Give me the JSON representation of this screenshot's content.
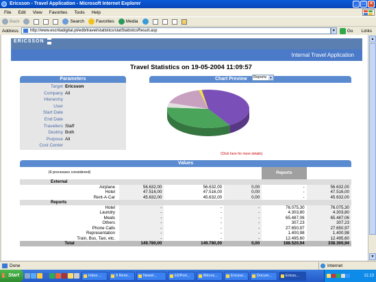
{
  "window": {
    "title": "Ericsson - Travel Application - Microsoft Internet Explorer",
    "min": "_",
    "max": "□",
    "close": "×"
  },
  "menu": [
    "File",
    "Edit",
    "View",
    "Favorites",
    "Tools",
    "Help"
  ],
  "toolbar": {
    "back": "Back",
    "search": "Search",
    "favorites": "Favorites",
    "media": "Media"
  },
  "address": {
    "label": "Address",
    "url": "http://www.escritadigital.pt/edb/travel/statistics/statStatisticsResult.asp",
    "go": "Go",
    "links": "Links"
  },
  "header": {
    "brand": "ERICSSON",
    "app_name": "Internal Travel Application"
  },
  "page_title": "Travel Statistics on 19-05-2004 11:09:57",
  "parameters": {
    "title": "Parameters",
    "rows": [
      {
        "k": "Target",
        "v": "Ericsson",
        "bold": true
      },
      {
        "k": "Company",
        "v": "All"
      },
      {
        "k": "Hierarchy",
        "v": ""
      },
      {
        "k": "User",
        "v": ""
      },
      {
        "k": "Start Date",
        "v": ""
      },
      {
        "k": "End Date",
        "v": ""
      },
      {
        "k": "Travellers",
        "v": "Staff"
      },
      {
        "k": "Destiny",
        "v": "Both"
      },
      {
        "k": "Purpose",
        "v": "All"
      },
      {
        "k": "Cost Center",
        "v": ""
      }
    ]
  },
  "chart_preview": {
    "title": "Chart Preview",
    "select_value": "Reports",
    "note": "(Click here for more details)"
  },
  "chart_data": {
    "type": "pie",
    "title": "",
    "slices": [
      {
        "value": 188520.94,
        "color": "#7a4fb8"
      },
      {
        "value": 149780.0,
        "color": "#4aa45a"
      },
      {
        "value": 17000,
        "color": "#e0e0e0"
      },
      {
        "value": 70000,
        "color": "#c8a0c0"
      },
      {
        "value": 5000,
        "color": "#f0e040"
      }
    ]
  },
  "values": {
    "title": "Values",
    "processes_note": "(6 processes considered)",
    "headers": {
      "budget": "Budget",
      "values_line1": "Values",
      "values_line2": "To Be Invoiced",
      "invoiced": "Invoiced",
      "reports": "Reports",
      "total": "Total"
    },
    "sections": [
      {
        "name": "External",
        "rows": [
          {
            "label": "Airplane",
            "budget": "56.632,00",
            "tbi": "56.632,00",
            "invoiced": "0,00",
            "reports": "-",
            "total": "56.632,00"
          },
          {
            "label": "Hotel",
            "budget": "47.516,00",
            "tbi": "47.516,00",
            "invoiced": "0,00",
            "reports": "-",
            "total": "47.516,00"
          },
          {
            "label": "Rent-A-Car",
            "budget": "45.632,00",
            "tbi": "45.632,00",
            "invoiced": "0,00",
            "reports": "-",
            "total": "45.632,00"
          }
        ]
      },
      {
        "name": "Reports",
        "rows": [
          {
            "label": "Hotel",
            "budget": "-",
            "tbi": "-",
            "invoiced": "-",
            "reports": "76.075,30",
            "total": "76.075,30"
          },
          {
            "label": "Laundry",
            "budget": "-",
            "tbi": "-",
            "invoiced": "-",
            "reports": "4.303,80",
            "total": "4.303,80"
          },
          {
            "label": "Meals",
            "budget": "-",
            "tbi": "-",
            "invoiced": "-",
            "reports": "65.487,06",
            "total": "65.487,06"
          },
          {
            "label": "Others",
            "budget": "-",
            "tbi": "-",
            "invoiced": "-",
            "reports": "307,23",
            "total": "307,23"
          },
          {
            "label": "Phone Calls",
            "budget": "-",
            "tbi": "-",
            "invoiced": "-",
            "reports": "27.650,97",
            "total": "27.650,97"
          },
          {
            "label": "Representation",
            "budget": "-",
            "tbi": "-",
            "invoiced": "-",
            "reports": "1.400,98",
            "total": "1.400,98"
          },
          {
            "label": "Train, Bus, Taxi, etc.",
            "budget": "-",
            "tbi": "-",
            "invoiced": "-",
            "reports": "12.495,60",
            "total": "12.495,60"
          }
        ]
      }
    ],
    "total": {
      "label": "Total",
      "budget": "149.780,00",
      "tbi": "149.780,00",
      "invoiced": "0,00",
      "reports": "188.520,94",
      "total": "338.300,94"
    }
  },
  "status": {
    "text": "Done",
    "zone": "Internet"
  },
  "taskbar": {
    "start": "Start",
    "tasks": [
      "Inbox ...",
      "9 Remi...",
      "Newel...",
      "EDPort...",
      "Micros...",
      "Ericsso...",
      "Docum...",
      "Ericss..."
    ],
    "active_index": 7,
    "clock": "11:13"
  }
}
